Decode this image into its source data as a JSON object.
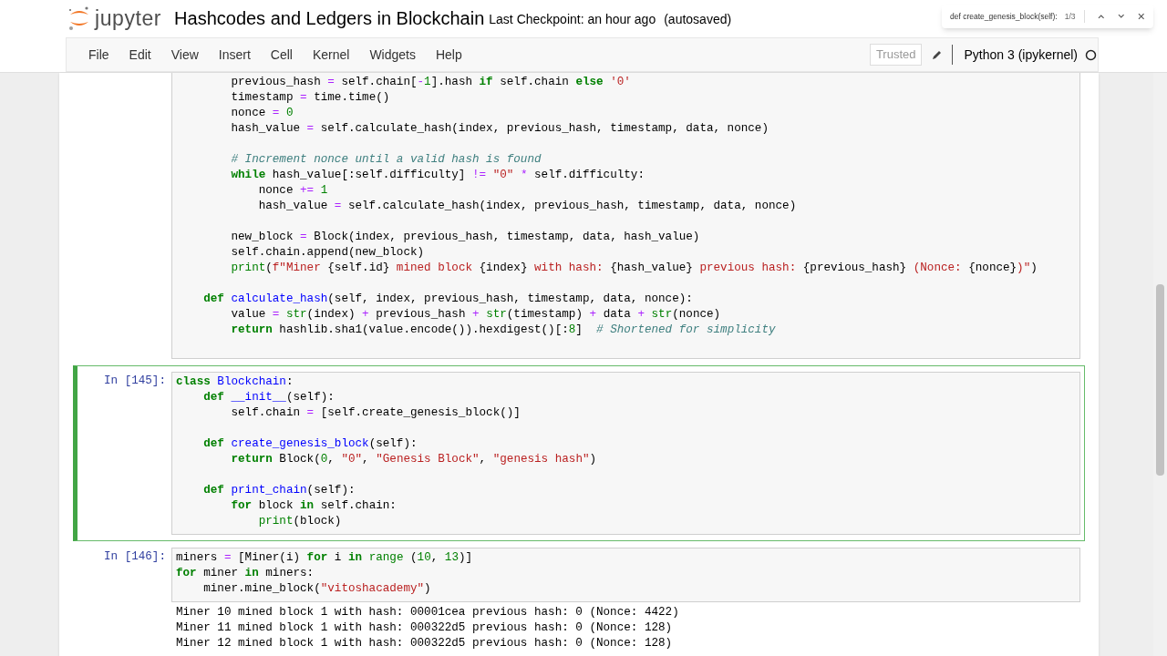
{
  "header": {
    "logo_text": "jupyter",
    "notebook_title": "Hashcodes and Ledgers in Blockchain",
    "checkpoint": "Last Checkpoint: an hour ago",
    "autosave": "(autosaved)"
  },
  "find_widget": {
    "query": "def create_genesis_block(self):",
    "count": "1/3"
  },
  "menu": [
    "File",
    "Edit",
    "View",
    "Insert",
    "Cell",
    "Kernel",
    "Widgets",
    "Help"
  ],
  "trusted": "Trusted",
  "kernel": "Python 3 (ipykernel)",
  "cells": [
    {
      "selected": false,
      "blocks": [
        [
          [
            {
              "kind": "text",
              "text": "        previous_hash "
            },
            {
              "kind": "operator",
              "text": "="
            },
            {
              "kind": "text",
              "text": " self.chain["
            },
            {
              "kind": "operator",
              "text": "-"
            },
            {
              "kind": "number",
              "text": "1"
            },
            {
              "kind": "text",
              "text": "].hash "
            },
            {
              "kind": "keyword",
              "text": "if"
            },
            {
              "kind": "text",
              "text": " self.chain "
            },
            {
              "kind": "keyword",
              "text": "else"
            },
            {
              "kind": "string",
              "text": " '0'"
            }
          ],
          [
            {
              "kind": "text",
              "text": "        timestamp "
            },
            {
              "kind": "operator",
              "text": "="
            },
            {
              "kind": "text",
              "text": " time.time()"
            }
          ],
          [
            {
              "kind": "text",
              "text": "        nonce "
            },
            {
              "kind": "operator",
              "text": "="
            },
            {
              "kind": "number",
              "text": " 0"
            }
          ],
          [
            {
              "kind": "text",
              "text": "        hash_value "
            },
            {
              "kind": "operator",
              "text": "="
            },
            {
              "kind": "text",
              "text": " self.calculate_hash(index, previous_hash, timestamp, data, nonce)"
            }
          ]
        ],
        [
          [
            {
              "kind": "comment",
              "text": "        # Increment nonce until a valid hash is found"
            }
          ],
          [
            {
              "kind": "keyword",
              "text": "        while"
            },
            {
              "kind": "text",
              "text": " hash_value[:self.difficulty] "
            },
            {
              "kind": "operator",
              "text": "!="
            },
            {
              "kind": "string",
              "text": " \"0\""
            },
            {
              "kind": "operator",
              "text": " *"
            },
            {
              "kind": "text",
              "text": " self.difficulty:"
            }
          ],
          [
            {
              "kind": "text",
              "text": "            nonce "
            },
            {
              "kind": "operator",
              "text": "+="
            },
            {
              "kind": "number",
              "text": " 1"
            }
          ],
          [
            {
              "kind": "text",
              "text": "            hash_value "
            },
            {
              "kind": "operator",
              "text": "="
            },
            {
              "kind": "text",
              "text": " self.calculate_hash(index, previous_hash, timestamp, data, nonce)"
            }
          ]
        ],
        [
          [
            {
              "kind": "text",
              "text": "        new_block "
            },
            {
              "kind": "operator",
              "text": "="
            },
            {
              "kind": "text",
              "text": " Block(index, previous_hash, timestamp, data, hash_value)"
            }
          ],
          [
            {
              "kind": "text",
              "text": "        self.chain.append(new_block)"
            }
          ],
          [
            {
              "kind": "builtin",
              "text": "        print"
            },
            {
              "kind": "text",
              "text": "("
            },
            {
              "kind": "string",
              "text": "f\"Miner "
            },
            {
              "kind": "text",
              "text": "{self.id}"
            },
            {
              "kind": "string",
              "text": " mined block "
            },
            {
              "kind": "text",
              "text": "{index}"
            },
            {
              "kind": "string",
              "text": " with hash: "
            },
            {
              "kind": "text",
              "text": "{hash_value}"
            },
            {
              "kind": "string",
              "text": " previous hash: "
            },
            {
              "kind": "text",
              "text": "{previous_hash}"
            },
            {
              "kind": "string",
              "text": " (Nonce: "
            },
            {
              "kind": "text",
              "text": "{nonce}"
            },
            {
              "kind": "string",
              "text": ")\""
            },
            {
              "kind": "text",
              "text": ")"
            }
          ]
        ],
        [
          [
            {
              "kind": "keyword",
              "text": "    def"
            },
            {
              "kind": "function",
              "text": " calculate_hash"
            },
            {
              "kind": "text",
              "text": "(self, index, previous_hash, timestamp, data, nonce):"
            }
          ],
          [
            {
              "kind": "text",
              "text": "        value "
            },
            {
              "kind": "operator",
              "text": "="
            },
            {
              "kind": "builtin",
              "text": " str"
            },
            {
              "kind": "text",
              "text": "(index) "
            },
            {
              "kind": "operator",
              "text": "+"
            },
            {
              "kind": "text",
              "text": " previous_hash "
            },
            {
              "kind": "operator",
              "text": "+"
            },
            {
              "kind": "builtin",
              "text": " str"
            },
            {
              "kind": "text",
              "text": "(timestamp) "
            },
            {
              "kind": "operator",
              "text": "+"
            },
            {
              "kind": "text",
              "text": " data "
            },
            {
              "kind": "operator",
              "text": "+"
            },
            {
              "kind": "builtin",
              "text": " str"
            },
            {
              "kind": "text",
              "text": "(nonce)"
            }
          ],
          [
            {
              "kind": "keyword",
              "text": "        return"
            },
            {
              "kind": "text",
              "text": " hashlib.sha1(value.encode()).hexdigest()[:"
            },
            {
              "kind": "number",
              "text": "8"
            },
            {
              "kind": "text",
              "text": "]"
            },
            {
              "kind": "comment",
              "text": "  # Shortened for simplicity"
            }
          ]
        ]
      ]
    },
    {
      "selected": true,
      "prompt": "In [145]:",
      "blocks": [
        [
          [
            {
              "kind": "keyword",
              "text": "class"
            },
            {
              "kind": "function",
              "text": " Blockchain"
            },
            {
              "kind": "text",
              "text": ":"
            }
          ],
          [
            {
              "kind": "keyword",
              "text": "    def"
            },
            {
              "kind": "function",
              "text": " __init__"
            },
            {
              "kind": "text",
              "text": "(self):"
            }
          ],
          [
            {
              "kind": "text",
              "text": "        self.chain "
            },
            {
              "kind": "operator",
              "text": "="
            },
            {
              "kind": "text",
              "text": " [self.create_genesis_block()]"
            }
          ]
        ],
        [
          [
            {
              "kind": "keyword",
              "text": "    def"
            },
            {
              "kind": "function",
              "text": " create_genesis_block"
            },
            {
              "kind": "text",
              "text": "(self):"
            }
          ],
          [
            {
              "kind": "keyword",
              "text": "        return"
            },
            {
              "kind": "text",
              "text": " Block("
            },
            {
              "kind": "number",
              "text": "0"
            },
            {
              "kind": "text",
              "text": ", "
            },
            {
              "kind": "string",
              "text": "\"0\""
            },
            {
              "kind": "text",
              "text": ", "
            },
            {
              "kind": "string",
              "text": "\"Genesis Block\""
            },
            {
              "kind": "text",
              "text": ", "
            },
            {
              "kind": "string",
              "text": "\"genesis hash\""
            },
            {
              "kind": "text",
              "text": ")"
            }
          ]
        ],
        [
          [
            {
              "kind": "keyword",
              "text": "    def"
            },
            {
              "kind": "function",
              "text": " print_chain"
            },
            {
              "kind": "text",
              "text": "(self):"
            }
          ],
          [
            {
              "kind": "keyword",
              "text": "        for"
            },
            {
              "kind": "text",
              "text": " block "
            },
            {
              "kind": "keyword",
              "text": "in"
            },
            {
              "kind": "text",
              "text": " self.chain:"
            }
          ],
          [
            {
              "kind": "builtin",
              "text": "            print"
            },
            {
              "kind": "text",
              "text": "(block)"
            }
          ]
        ]
      ]
    },
    {
      "selected": false,
      "prompt": "In [146]:",
      "blocks": [
        [
          [
            {
              "kind": "text",
              "text": "miners "
            },
            {
              "kind": "operator",
              "text": "="
            },
            {
              "kind": "text",
              "text": " [Miner(i) "
            },
            {
              "kind": "keyword",
              "text": "for"
            },
            {
              "kind": "text",
              "text": " i "
            },
            {
              "kind": "keyword",
              "text": "in"
            },
            {
              "kind": "builtin",
              "text": " range"
            },
            {
              "kind": "text",
              "text": " ("
            },
            {
              "kind": "number",
              "text": "10"
            },
            {
              "kind": "text",
              "text": ", "
            },
            {
              "kind": "number",
              "text": "13"
            },
            {
              "kind": "text",
              "text": ")]"
            }
          ],
          [
            {
              "kind": "keyword",
              "text": "for"
            },
            {
              "kind": "text",
              "text": " miner "
            },
            {
              "kind": "keyword",
              "text": "in"
            },
            {
              "kind": "text",
              "text": " miners:"
            }
          ],
          [
            {
              "kind": "text",
              "text": "    miner.mine_block("
            },
            {
              "kind": "string",
              "text": "\"vitoshacademy\""
            },
            {
              "kind": "text",
              "text": ")"
            }
          ]
        ]
      ],
      "output": [
        "Miner 10 mined block 1 with hash: 00001cea previous hash: 0 (Nonce: 4422)",
        "Miner 11 mined block 1 with hash: 000322d5 previous hash: 0 (Nonce: 128)",
        "Miner 12 mined block 1 with hash: 000322d5 previous hash: 0 (Nonce: 128)"
      ]
    }
  ]
}
